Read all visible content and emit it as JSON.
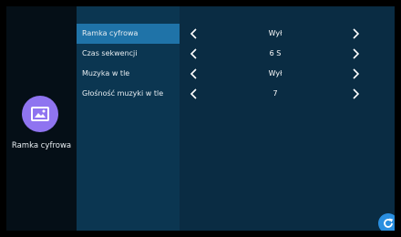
{
  "sidebar": {
    "icon": "picture-frame-icon",
    "label": "Ramka cyfrowa"
  },
  "settings": [
    {
      "label": "Ramka cyfrowa",
      "value": "Wył",
      "selected": true
    },
    {
      "label": "Czas sekwencji",
      "value": "6 S",
      "selected": false
    },
    {
      "label": "Muzyka w tle",
      "value": "Wył",
      "selected": false
    },
    {
      "label": "Głośność muzyki w tle",
      "value": "7",
      "selected": false
    }
  ],
  "controls": {
    "left_arrow_icon": "chevron-left-icon",
    "right_arrow_icon": "chevron-right-icon",
    "refresh_icon": "refresh-icon"
  },
  "colors": {
    "selected_row": "#1f73a8",
    "sidebar_icon_bg": "#8f74f0",
    "refresh_button_bg": "#2a8fe0"
  }
}
